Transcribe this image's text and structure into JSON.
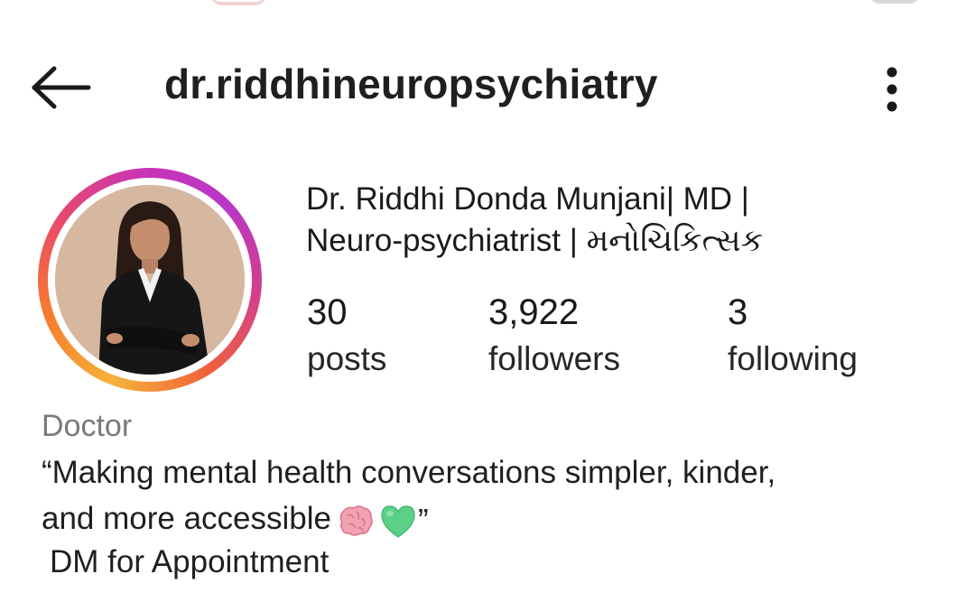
{
  "header": {
    "username": "dr.riddhineuropsychiatry",
    "back_icon": "arrow-left-icon",
    "menu_icon": "more-vertical-icon"
  },
  "profile": {
    "name_line1": "Dr. Riddhi Donda Munjani| MD |",
    "name_line2": "Neuro-psychiatrist | મનોચિકિત્સક",
    "stats": {
      "posts_count": "30",
      "posts_label": "posts",
      "followers_count": "3,922",
      "followers_label": "followers",
      "following_count": "3",
      "following_label": "following"
    }
  },
  "bio": {
    "category": "Doctor",
    "line1": "“Making mental health conversations simpler, kinder,",
    "line2": "and more accessible",
    "emojis": [
      "brain-emoji",
      "green-heart-emoji"
    ],
    "line2_close": "”",
    "cta": "DM for Appointment"
  },
  "colors": {
    "story_ring": [
      "#f6b23a",
      "#f77b2c",
      "#e9496a",
      "#c935b4"
    ],
    "text_primary": "#1a1a1a",
    "text_secondary": "#7a7a7a"
  }
}
